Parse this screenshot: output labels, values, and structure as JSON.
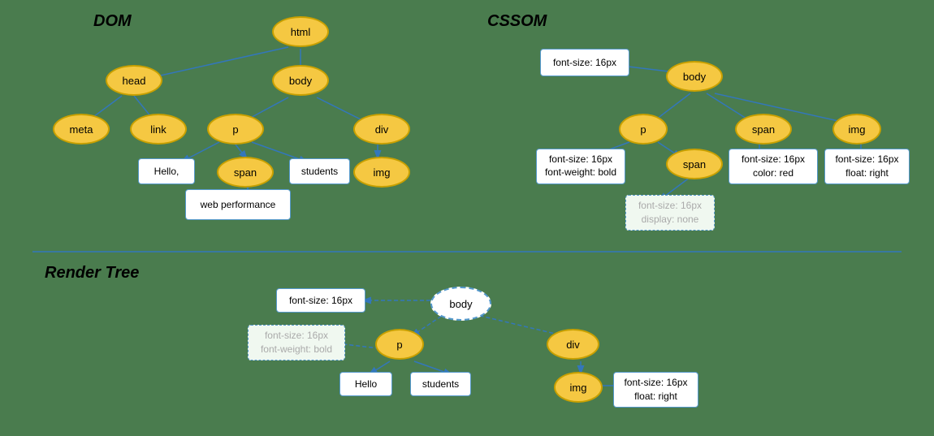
{
  "sections": {
    "dom_label": "DOM",
    "cssom_label": "CSSOM",
    "render_tree_label": "Render Tree"
  },
  "dom": {
    "nodes": {
      "html": "html",
      "head": "head",
      "body": "body",
      "meta": "meta",
      "link": "link",
      "p": "p",
      "div": "div",
      "span": "span",
      "img_dom": "img"
    },
    "text_nodes": {
      "hello": "Hello,",
      "students": "students",
      "web_perf": "web performance"
    }
  },
  "cssom": {
    "nodes": {
      "body": "body",
      "p": "p",
      "span_outer": "span",
      "img": "img",
      "span_inner": "span"
    },
    "boxes": {
      "body_style": "font-size: 16px",
      "p_style": "font-size: 16px\nfont-weight: bold",
      "span_outer_style": "font-size: 16px\ncolor: red",
      "img_style": "font-size: 16px\nfloat: right",
      "span_inner_style": "font-size: 16px\ndisplay: none"
    }
  },
  "render_tree": {
    "nodes": {
      "body": "body",
      "p": "p",
      "div": "div",
      "img": "img"
    },
    "text_nodes": {
      "hello": "Hello",
      "students": "students"
    },
    "boxes": {
      "body_style": "font-size: 16px",
      "p_style": "font-size: 16px\nfont-weight: bold",
      "img_style": "font-size: 16px\nfloat: right"
    }
  }
}
